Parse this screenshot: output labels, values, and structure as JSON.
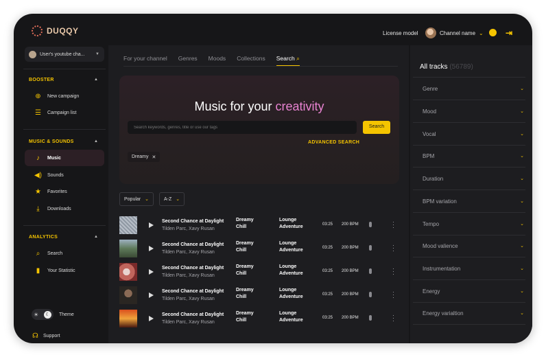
{
  "brand": {
    "name": "DUQQY"
  },
  "header": {
    "license_label": "License model",
    "channel_label": "Channel name"
  },
  "sidebar": {
    "user_select": "User's youtube cha...",
    "sections": [
      {
        "title": "BOOSTER",
        "items": [
          {
            "label": "New campaign",
            "icon": "plus-circle-icon"
          },
          {
            "label": "Campaign list",
            "icon": "list-icon"
          }
        ]
      },
      {
        "title": "MUSIC & SOUNDS",
        "items": [
          {
            "label": "Music",
            "icon": "music-note-icon",
            "active": true
          },
          {
            "label": "Sounds",
            "icon": "speaker-icon"
          },
          {
            "label": "Favorites",
            "icon": "star-icon"
          },
          {
            "label": "Downloads",
            "icon": "download-icon"
          }
        ]
      },
      {
        "title": "ANALYTICS",
        "items": [
          {
            "label": "Search",
            "icon": "search-icon"
          },
          {
            "label": "Your Statistic",
            "icon": "bar-chart-icon"
          }
        ]
      }
    ],
    "theme_label": "Theme",
    "support_label": "Support"
  },
  "main": {
    "tabs": [
      "For your channel",
      "Genres",
      "Moods",
      "Collections",
      "Search"
    ],
    "active_tab": "Search",
    "hero": {
      "title_prefix": "Music for your ",
      "title_accent": "creativity",
      "search_placeholder": "Search keywords, genres, title or use our tags",
      "search_button": "Search",
      "advanced_search": "ADVANCED SEARCH",
      "chip": "Dreamy"
    },
    "sort": {
      "order": "Popular",
      "alpha": "A-Z"
    },
    "tracks": [
      {
        "title": "Second Chance at Daylight",
        "artist": "Tilden Parc, Xavy Rusan",
        "mood1": "Dreamy",
        "mood2": "Chill",
        "genre1": "Lounge",
        "genre2": "Adventure",
        "duration": "03:25",
        "bpm": "200 BPM"
      },
      {
        "title": "Second Chance at Daylight",
        "artist": "Tilden Parc, Xavy Rusan",
        "mood1": "Dreamy",
        "mood2": "Chill",
        "genre1": "Lounge",
        "genre2": "Adventure",
        "duration": "03:25",
        "bpm": "200 BPM"
      },
      {
        "title": "Second Chance at Daylight",
        "artist": "Tilden Parc, Xavy Rusan",
        "mood1": "Dreamy",
        "mood2": "Chill",
        "genre1": "Lounge",
        "genre2": "Adventure",
        "duration": "03:25",
        "bpm": "200 BPM"
      },
      {
        "title": "Second Chance at Daylight",
        "artist": "Tilden Parc, Xavy Rusan",
        "mood1": "Dreamy",
        "mood2": "Chill",
        "genre1": "Lounge",
        "genre2": "Adventure",
        "duration": "03:25",
        "bpm": "200 BPM"
      },
      {
        "title": "Second Chance at Daylight",
        "artist": "Tilden Parc, Xavy Rusan",
        "mood1": "Dreamy",
        "mood2": "Chill",
        "genre1": "Lounge",
        "genre2": "Adventure",
        "duration": "03:25",
        "bpm": "200 BPM"
      }
    ]
  },
  "right_panel": {
    "title": "All tracks",
    "count": "(56789)",
    "filters": [
      "Genre",
      "Mood",
      "Vocal",
      "BPM",
      "Duration",
      "BPM variation",
      "Tempo",
      "Mood valience",
      "Instrumentation",
      "Energy",
      "Energy varialtion"
    ]
  },
  "colors": {
    "accent": "#f5c400",
    "highlight": "#e883d1",
    "background": "#161618",
    "panel": "#1d1d20"
  }
}
